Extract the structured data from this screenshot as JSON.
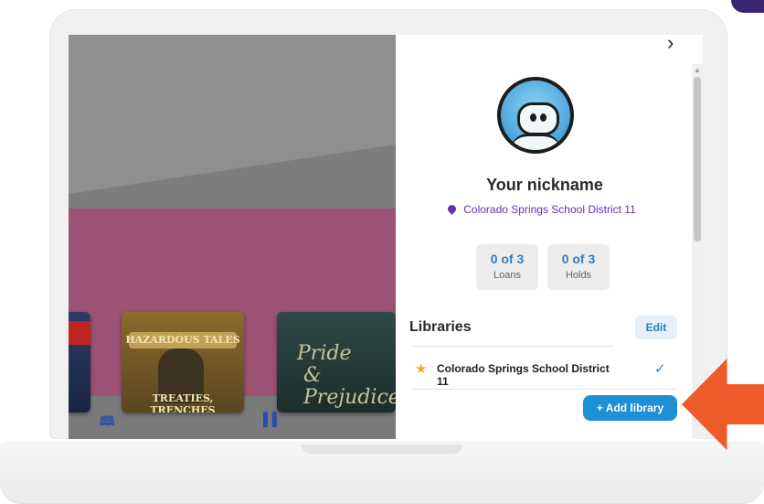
{
  "panel": {
    "nickname": "Your nickname",
    "district": "Colorado Springs School District 11",
    "stats": [
      {
        "value": "0 of 3",
        "label": "Loans"
      },
      {
        "value": "0 of 3",
        "label": "Holds"
      }
    ],
    "libraries_heading": "Libraries",
    "edit_label": "Edit",
    "libraries": [
      {
        "name": "Colorado Springs School District 11",
        "selected": true
      }
    ],
    "add_library_label": "+ Add library"
  },
  "books": [
    {
      "title_lines": [
        "HAZARDOUS",
        "TALES"
      ],
      "subtitle_lines": [
        "TREATIES,",
        "TRENCHES"
      ]
    },
    {
      "title_lines": [
        "Pride",
        "&",
        "Prejudice"
      ]
    }
  ],
  "icons": {
    "close": "chevron-right-icon",
    "location": "map-pin-icon",
    "primary_library": "star-icon",
    "selected": "checkmark-icon",
    "nav_library": "books-icon",
    "nav_shelf": "bookshelf-icon"
  },
  "colors": {
    "accent_blue": "#1f8fd6",
    "district_purple": "#6b2fb0",
    "callout_orange": "#ee5b2a",
    "background_pink": "#9b5274"
  }
}
